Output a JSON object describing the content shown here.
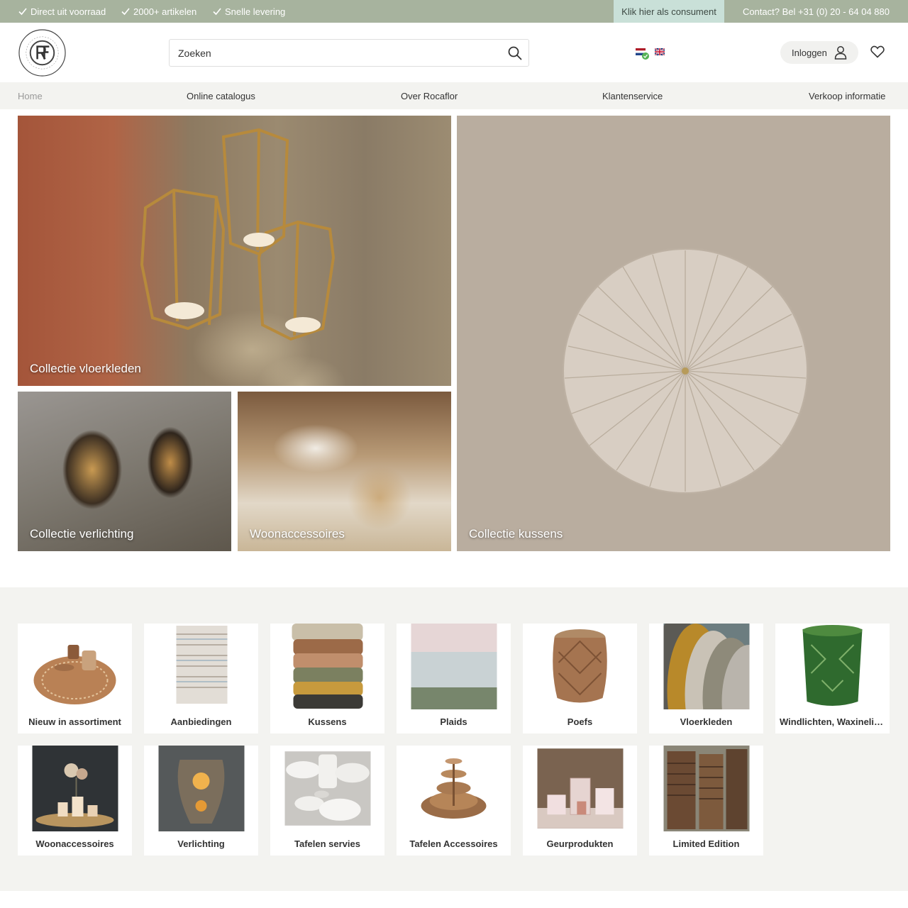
{
  "topbar": {
    "usps": [
      "Direct uit voorraad",
      "2000+ artikelen",
      "Snelle levering"
    ],
    "consumer_link": "Klik hier als consument",
    "contact": "Contact? Bel +31 (0) 20 - 64 04 880"
  },
  "header": {
    "search_placeholder": "Zoeken",
    "login_label": "Inloggen"
  },
  "nav": {
    "items": [
      "Home",
      "Online catalogus",
      "Over Rocaflor",
      "Klantenservice",
      "Verkoop informatie"
    ]
  },
  "hero": {
    "tiles": [
      "Collectie vloerkleden",
      "Collectie verlichting",
      "Woonaccessoires",
      "Collectie kussens"
    ]
  },
  "categories": [
    "Nieuw in assortiment",
    "Aanbiedingen",
    "Kussens",
    "Plaids",
    "Poefs",
    "Vloerkleden",
    "Windlichten, Waxinelichthouders",
    "Woonaccessoires",
    "Verlichting",
    "Tafelen servies",
    "Tafelen Accessoires",
    "Geurprodukten",
    "Limited Edition"
  ],
  "colors": {
    "topbar": "#a7b39e",
    "consumer": "#c9e0d8",
    "nav_bg": "#f3f3f0"
  }
}
